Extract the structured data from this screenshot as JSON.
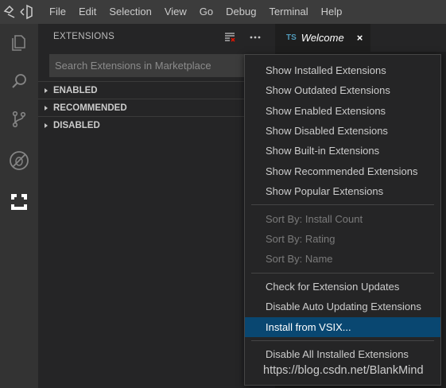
{
  "menubar": [
    "File",
    "Edit",
    "Selection",
    "View",
    "Go",
    "Debug",
    "Terminal",
    "Help"
  ],
  "activitybar": {
    "icons": [
      "explorer-icon",
      "search-icon",
      "source-control-icon",
      "debug-icon",
      "extensions-icon"
    ]
  },
  "sidebar": {
    "title": "EXTENSIONS",
    "search_placeholder": "Search Extensions in Marketplace",
    "sections": [
      "ENABLED",
      "RECOMMENDED",
      "DISABLED"
    ]
  },
  "tab": {
    "lang_badge": "TS",
    "label": "Welcome",
    "close_glyph": "×"
  },
  "context_menu": {
    "groups": [
      [
        "Show Installed Extensions",
        "Show Outdated Extensions",
        "Show Enabled Extensions",
        "Show Disabled Extensions",
        "Show Built-in Extensions",
        "Show Recommended Extensions",
        "Show Popular Extensions"
      ],
      [
        "Sort By: Install Count",
        "Sort By: Rating",
        "Sort By: Name"
      ],
      [
        "Check for Extension Updates",
        "Disable Auto Updating Extensions",
        "Install from VSIX..."
      ],
      [
        "Disable All Installed Extensions"
      ]
    ],
    "disabled_items": [
      "Sort By: Install Count",
      "Sort By: Rating",
      "Sort By: Name"
    ],
    "selected_item": "Install from VSIX..."
  },
  "watermark": "https://blog.csdn.net/BlankMind",
  "colors": {
    "accent_selected": "#094771",
    "ts_badge": "#519aba"
  }
}
